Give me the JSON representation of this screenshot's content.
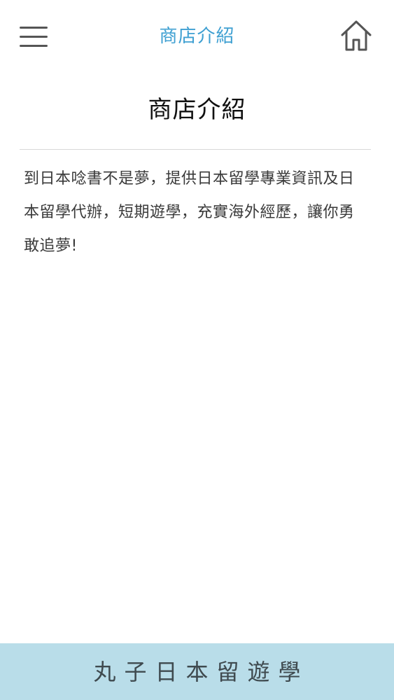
{
  "header": {
    "title": "商店介紹",
    "menu_icon": "hamburger-menu-icon",
    "home_icon": "home-icon"
  },
  "main": {
    "page_title": "商店介紹",
    "description": "到日本唸書不是夢，提供日本留學專業資訊及日本留學代辦，短期遊學，充實海外經歷，讓你勇敢追夢!"
  },
  "footer": {
    "brand": "丸子日本留遊學"
  },
  "colors": {
    "accent": "#3fa0d2",
    "footer_bg": "#b9dde9",
    "text": "#3a3a3a",
    "title": "#111111"
  }
}
